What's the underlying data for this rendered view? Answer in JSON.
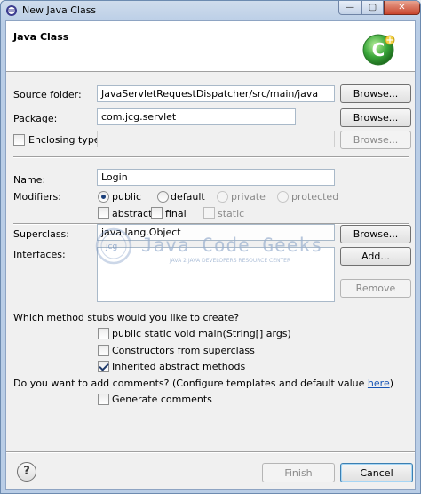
{
  "window": {
    "title": "New Java Class",
    "controls": {
      "minimize": "—",
      "maximize": "▢",
      "close": "✕"
    }
  },
  "banner": {
    "title": "Java Class"
  },
  "source_folder": {
    "label": "Source folder:",
    "value": "JavaServletRequestDispatcher/src/main/java",
    "browse": "Browse..."
  },
  "package": {
    "label": "Package:",
    "value": "com.jcg.servlet",
    "browse": "Browse..."
  },
  "enclosing_type": {
    "label": "Enclosing type:",
    "value": "",
    "browse": "Browse...",
    "checked": false
  },
  "name": {
    "label": "Name:",
    "value": "Login"
  },
  "modifiers": {
    "label": "Modifiers:",
    "access": [
      {
        "label": "public",
        "selected": true,
        "enabled": true
      },
      {
        "label": "default",
        "selected": false,
        "enabled": true
      },
      {
        "label": "private",
        "selected": false,
        "enabled": false
      },
      {
        "label": "protected",
        "selected": false,
        "enabled": false
      }
    ],
    "flags": [
      {
        "label": "abstract",
        "checked": false,
        "enabled": true
      },
      {
        "label": "final",
        "checked": false,
        "enabled": true
      },
      {
        "label": "static",
        "checked": false,
        "enabled": false
      }
    ]
  },
  "superclass": {
    "label": "Superclass:",
    "value": "java.lang.Object",
    "browse": "Browse..."
  },
  "interfaces": {
    "label": "Interfaces:",
    "add": "Add...",
    "remove": "Remove"
  },
  "watermark": {
    "text": "Java Code Geeks",
    "subtitle": "JAVA 2 JAVA DEVELOPERS RESOURCE CENTER",
    "badge": "jcg"
  },
  "stubs": {
    "question": "Which method stubs would you like to create?",
    "options": [
      {
        "label": "public static void main(String[] args)",
        "checked": false
      },
      {
        "label": "Constructors from superclass",
        "checked": false
      },
      {
        "label": "Inherited abstract methods",
        "checked": true
      }
    ]
  },
  "comments": {
    "question_prefix": "Do you want to add comments? (Configure templates and default value ",
    "link": "here",
    "question_suffix": ")",
    "option": {
      "label": "Generate comments",
      "checked": false
    }
  },
  "footer": {
    "help": "?",
    "finish": "Finish",
    "cancel": "Cancel"
  },
  "colors": {
    "accent": "#3c7fb1",
    "logo_green": "#3aa73a",
    "link": "#1a56b5"
  }
}
